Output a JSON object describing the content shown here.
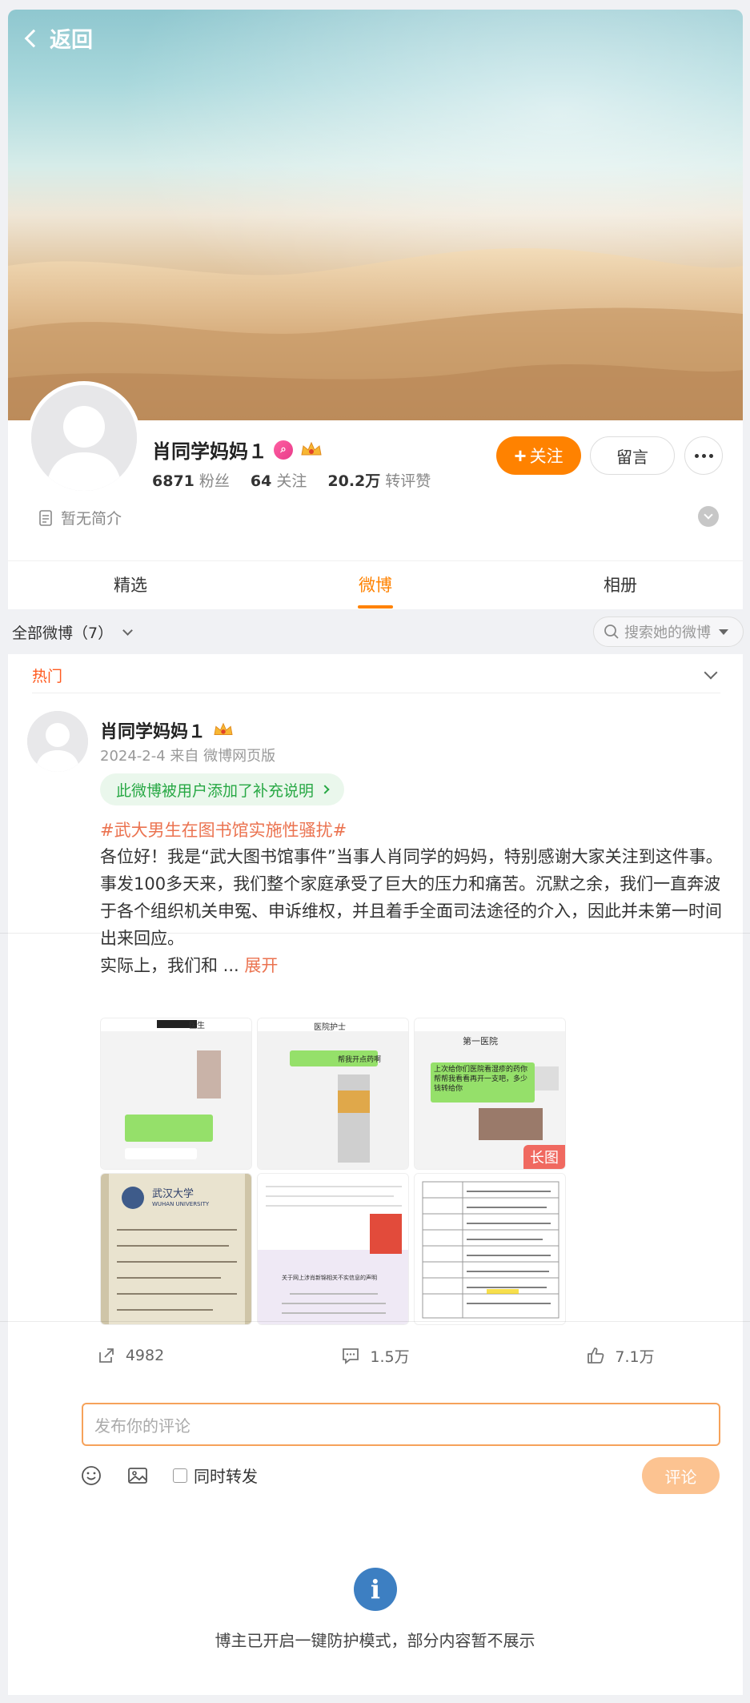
{
  "header": {
    "back_label": "返回"
  },
  "profile": {
    "name": "肖同学妈妈１",
    "followers_count": "6871",
    "followers_label": "粉丝",
    "following_count": "64",
    "following_label": "关注",
    "likes_count": "20.2万",
    "likes_label": "转评赞",
    "follow_button": "关注",
    "message_button": "留言",
    "bio": "暂无简介"
  },
  "tabs": [
    {
      "label": "精选"
    },
    {
      "label": "微博",
      "active": true
    },
    {
      "label": "相册"
    }
  ],
  "filter": {
    "label": "全部微博（7）",
    "search_placeholder": "搜索她的微博"
  },
  "feed": {
    "section_label": "热门",
    "post": {
      "author": "肖同学妈妈１",
      "meta": "2024-2-4  来自 微博网页版",
      "supplement_label": "此微博被用户添加了补充说明",
      "hashtag": "#武大男生在图书馆实施性骚扰#",
      "body_lines": [
        "各位好！我是“武大图书馆事件”当事人肖同学的妈妈，特别感谢大家关注到这件事。",
        "事发100多天来，我们整个家庭承受了巨大的压力和痛苦。沉默之余，我们一直奔波于各个组织机关申冤、申诉维权，并且着手全面司法途径的介入，因此并未第一时间出来回应。",
        "实际上，我们和  ..."
      ],
      "expand_label": "展开",
      "images": [
        {
          "top": "医生",
          "caption": ""
        },
        {
          "top": "医院护士",
          "caption": "帮我开点药啊"
        },
        {
          "top": "第一医院",
          "caption": "上次给你们医院看湿疹的药你帮帮我看看再开一支吧，多少钱转给你",
          "long": "长图"
        },
        {
          "top": "武汉大学",
          "caption": "WUHAN UNIVERSITY"
        },
        {
          "top": "",
          "caption": "关于网上涉肖新锦相关不实信息的声明"
        },
        {
          "top": "",
          "caption": ""
        }
      ],
      "repost_count": "4982",
      "comment_count": "1.5万",
      "like_count": "7.1万"
    }
  },
  "comment_box": {
    "placeholder": "发布你的评论",
    "repost_label": "同时转发",
    "submit_label": "评论"
  },
  "notice": "博主已开启一键防护模式，部分内容暂不展示",
  "colors": {
    "accent": "#ff8200",
    "link": "#eb7350",
    "green": "#27a844",
    "info": "#3d7fc2"
  }
}
